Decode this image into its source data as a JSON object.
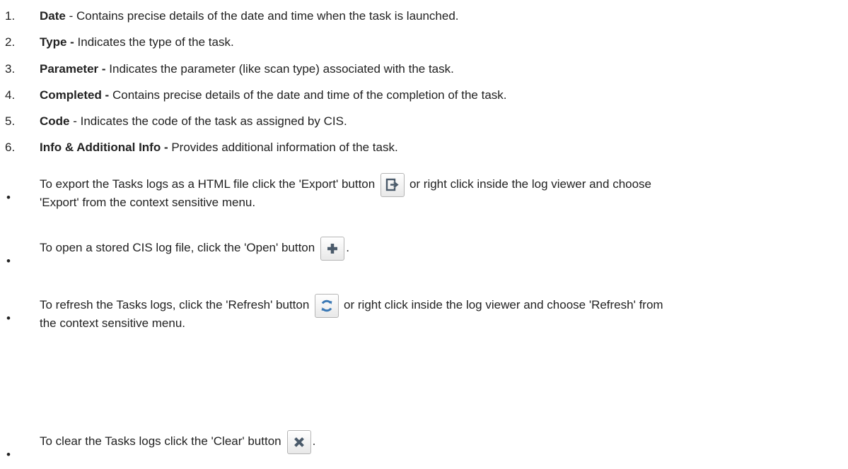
{
  "items": [
    {
      "num": "1.",
      "term": "Date",
      "desc": " - Contains precise details of the date and time when the task is launched."
    },
    {
      "num": "2.",
      "term": "Type -",
      "desc": " Indicates the type of the task."
    },
    {
      "num": "3.",
      "term": "Parameter -",
      "desc": " Indicates the parameter (like scan type) associated with the task."
    },
    {
      "num": "4.",
      "term": "Completed -",
      "desc": " Contains precise details of the date and time of the completion of the task."
    },
    {
      "num": "5.",
      "term": "Code",
      "desc": " - Indicates the code of the task as assigned by CIS."
    },
    {
      "num": "6.",
      "term": "Info & Additional Info -",
      "desc": " Provides additional information of the task."
    }
  ],
  "bullets": [
    {
      "bullet": "•",
      "before": "To export the Tasks logs as a HTML file click the 'Export' button",
      "after": " or right click inside the log viewer and choose",
      "line2": "'Export' from the context sensitive menu.",
      "icon": "export-icon"
    },
    {
      "bullet": "•",
      "before": "To open a stored CIS log file, click the 'Open' button",
      "after": ".",
      "icon": "plus-icon"
    },
    {
      "bullet": "•",
      "before": "To refresh the Tasks logs, click the 'Refresh' button",
      "after": " or right click inside the log viewer and choose 'Refresh' from",
      "line2": "the context sensitive menu.",
      "icon": "refresh-icon"
    },
    {
      "bullet": "•",
      "before": "To clear the Tasks logs click the 'Clear' button",
      "after": ".",
      "icon": "close-icon"
    }
  ],
  "colors": {
    "text": "#222222",
    "icon": "#4a5a6a",
    "refresh": "#3a78b5"
  }
}
